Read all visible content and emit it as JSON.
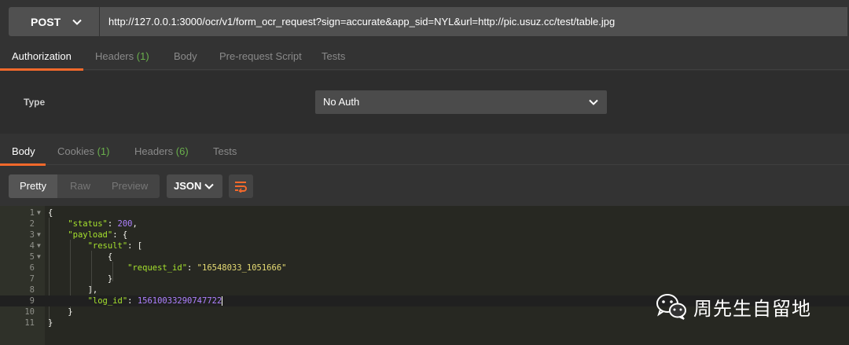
{
  "request": {
    "method": "POST",
    "url": "http://127.0.0.1:3000/ocr/v1/form_ocr_request?sign=accurate&app_sid=NYL&url=http://pic.usuz.cc/test/table.jpg"
  },
  "request_tabs": [
    {
      "label": "Authorization",
      "count": ""
    },
    {
      "label": "Headers",
      "count": "(1)"
    },
    {
      "label": "Body",
      "count": ""
    },
    {
      "label": "Pre-request Script",
      "count": ""
    },
    {
      "label": "Tests",
      "count": ""
    }
  ],
  "auth": {
    "type_label": "Type",
    "type_value": "No Auth"
  },
  "response_tabs": [
    {
      "label": "Body",
      "count": ""
    },
    {
      "label": "Cookies",
      "count": "(1)"
    },
    {
      "label": "Headers",
      "count": "(6)"
    },
    {
      "label": "Tests",
      "count": ""
    }
  ],
  "view_modes": [
    "Pretty",
    "Raw",
    "Preview"
  ],
  "format": "JSON",
  "code_lines": [
    {
      "num": "1",
      "fold": true
    },
    {
      "num": "2",
      "fold": false
    },
    {
      "num": "3",
      "fold": true
    },
    {
      "num": "4",
      "fold": true
    },
    {
      "num": "5",
      "fold": true
    },
    {
      "num": "6",
      "fold": false
    },
    {
      "num": "7",
      "fold": false
    },
    {
      "num": "8",
      "fold": false
    },
    {
      "num": "9",
      "fold": false
    },
    {
      "num": "10",
      "fold": false
    },
    {
      "num": "11",
      "fold": false
    }
  ],
  "json": {
    "status_key": "\"status\"",
    "status_value": "200",
    "payload_key": "\"payload\"",
    "result_key": "\"result\"",
    "request_id_key": "\"request_id\"",
    "request_id_value": "\"16548033_1051666\"",
    "log_id_key": "\"log_id\"",
    "log_id_value": "15610033290747722"
  },
  "watermark": {
    "text": "周先生自留地"
  },
  "colors": {
    "accent": "#f4692b",
    "count_green": "#6ab04c",
    "editor_bg": "#272822"
  }
}
